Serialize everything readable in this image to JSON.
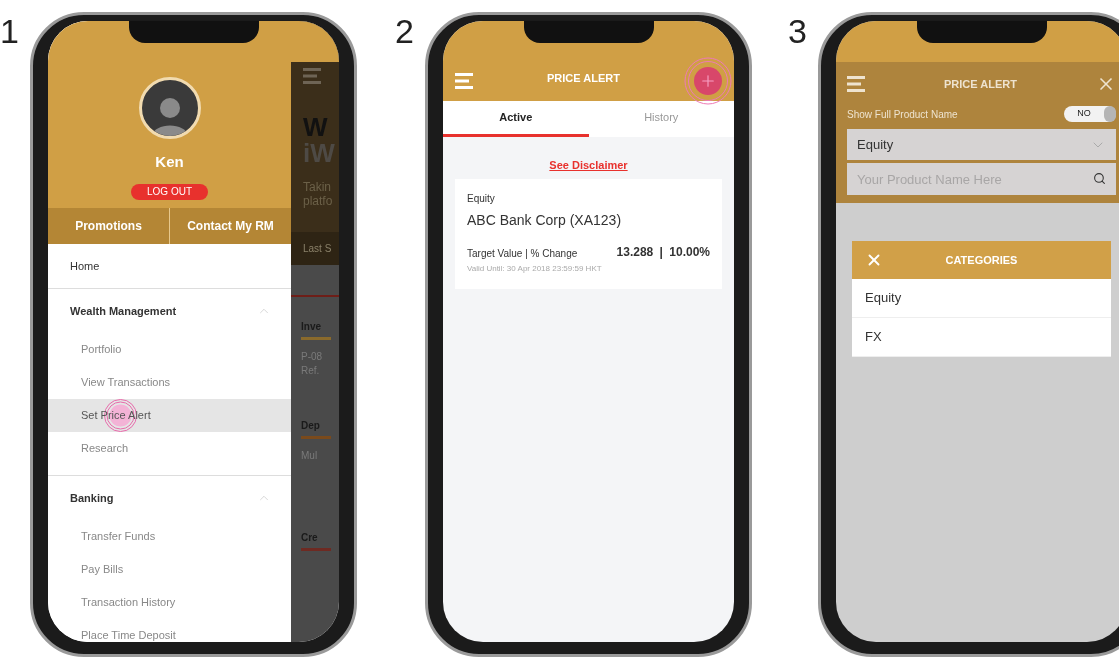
{
  "screen_1": {
    "step": "1",
    "profile": {
      "name": "Ken",
      "logout": "LOG OUT"
    },
    "quick_links": [
      "Promotions",
      "Contact My RM"
    ],
    "menu": [
      {
        "label": "Home",
        "kind": "link",
        "selected": false
      },
      {
        "label": "Wealth Management",
        "kind": "section",
        "expanded": true,
        "children": [
          {
            "label": "Portfolio",
            "selected": false
          },
          {
            "label": "View Transactions",
            "selected": false
          },
          {
            "label": "Set Price Alert",
            "selected": true
          },
          {
            "label": "Research",
            "selected": false
          }
        ]
      },
      {
        "label": "Banking",
        "kind": "section",
        "expanded": true,
        "children": [
          {
            "label": "Transfer Funds",
            "selected": false
          },
          {
            "label": "Pay Bills",
            "selected": false
          },
          {
            "label": "Transaction History",
            "selected": false
          },
          {
            "label": "Place Time Deposit",
            "selected": false
          }
        ]
      }
    ],
    "background_page": {
      "heading": [
        "W",
        "iW"
      ],
      "intro": [
        "Takin",
        "platfo"
      ],
      "bar": "Last S",
      "cards": [
        {
          "title": "Inve",
          "lines": [
            "P-08",
            "Ref."
          ],
          "color": "#8a6a2c"
        },
        {
          "title": "Dep",
          "lines": [
            "Mul"
          ],
          "color": "#7a4a1c"
        },
        {
          "title": "Cre",
          "color": "#6e2a22"
        }
      ]
    }
  },
  "screen_2": {
    "step": "2",
    "title": "PRICE ALERT",
    "tabs": [
      {
        "label": "Active",
        "selected": true
      },
      {
        "label": "History",
        "selected": false
      }
    ],
    "disclaimer_link": "See Disclaimer",
    "alerts": [
      {
        "category": "Equity",
        "product": "ABC Bank Corp (XA123)",
        "metric_label": "Target Value | % Change",
        "values": "13.288 | 10.00%",
        "valid_until": "Valid Until: 30 Apr 2018 23:59:59 HKT"
      }
    ]
  },
  "screen_3": {
    "step": "3",
    "title": "PRICE ALERT",
    "show_full_name": {
      "label": "Show Full Product Name",
      "toggle_text": "NO",
      "on": false
    },
    "category_select": {
      "value": "Equity"
    },
    "search": {
      "placeholder": "Your Product Name Here"
    },
    "categories_dialog": {
      "title": "CATEGORIES",
      "options": [
        {
          "label": "Equity"
        },
        {
          "label": "FX"
        }
      ]
    }
  }
}
